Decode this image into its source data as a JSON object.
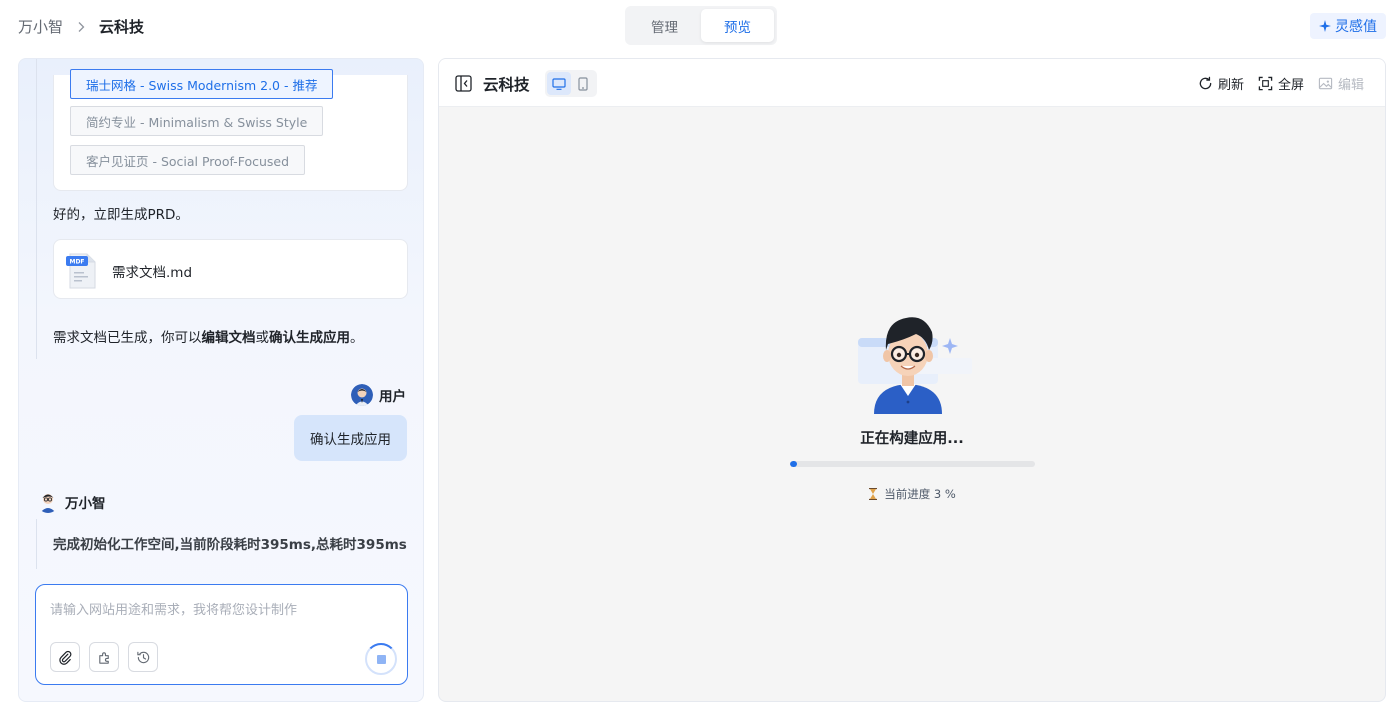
{
  "breadcrumb": {
    "root": "万小智",
    "current": "云科技"
  },
  "tabs": [
    {
      "label": "管理",
      "active": false
    },
    {
      "label": "预览",
      "active": true
    }
  ],
  "inspire_button": "灵感值",
  "chat": {
    "style_options": [
      {
        "label": "瑞士网格 - Swiss Modernism 2.0 - 推荐",
        "selected": true
      },
      {
        "label": "简约专业 - Minimalism & Swiss Style",
        "selected": false
      },
      {
        "label": "客户见证页 - Social Proof-Focused",
        "selected": false
      }
    ],
    "ai_reply_1": "好的，立即生成PRD。",
    "file": {
      "badge": "MDF",
      "name": "需求文档.md"
    },
    "ai_reply_2": {
      "prefix": "需求文档已生成，你可以",
      "action1": "编辑文档",
      "middle": "或",
      "action2": "确认生成应用",
      "suffix": "。"
    },
    "user_name": "用户",
    "user_message": "确认生成应用",
    "ai_name": "万小智",
    "ai_status": "完成初始化工作空间,当前阶段耗时395ms,总耗时395ms",
    "input": {
      "placeholder": "请输入网站用途和需求，我将帮您设计制作",
      "value": ""
    }
  },
  "preview": {
    "title": "云科技",
    "actions": {
      "refresh": "刷新",
      "fullscreen": "全屏",
      "edit": "编辑"
    },
    "build_status": "正在构建应用...",
    "progress_text": "当前进度 3 %",
    "progress_value": 3
  },
  "colors": {
    "accent": "#1f6fe8",
    "bubble": "#d6e5fb"
  }
}
